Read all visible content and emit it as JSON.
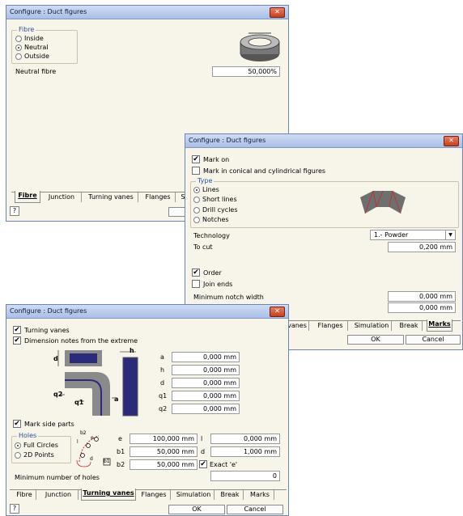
{
  "colors": {
    "title_bar": "#b7cae9",
    "window_bg": "#f7f4e9",
    "accent": "#2f4f9f",
    "close": "#d45a3a"
  },
  "w1": {
    "title": "Configure : Duct figures",
    "fibre_group": "Fibre",
    "options": [
      "Inside",
      "Neutral",
      "Outside"
    ],
    "selected": "Neutral",
    "neutral_fibre_label": "Neutral fibre",
    "neutral_fibre_value": "50,000%",
    "tabs": [
      "Fibre",
      "Junction",
      "Turning vanes",
      "Flanges",
      "Si"
    ],
    "active_tab": "Fibre",
    "help_icon": "help-icon"
  },
  "w2": {
    "title": "Configure : Duct figures",
    "mark_on": "Mark on",
    "mark_conical": "Mark in conical and cylindrical figures",
    "type_group": "Type",
    "type_options": [
      "Lines",
      "Short lines",
      "Drill cycles",
      "Notches"
    ],
    "type_selected": "Lines",
    "technology_label": "Technology",
    "technology_value": "1.- Powder",
    "to_cut_label": "To cut",
    "to_cut_value": "0,200 mm",
    "order": "Order",
    "join_ends": "Join ends",
    "min_notch_label": "Minimum notch width",
    "min_notch_value": "0,000 mm",
    "extra_value": "0,000 mm",
    "tabs": [
      "vanes",
      "Flanges",
      "Simulation",
      "Break",
      "Marks"
    ],
    "active_tab": "Marks",
    "ok": "OK",
    "cancel": "Cancel"
  },
  "w3": {
    "title": "Configure : Duct figures",
    "turning_vanes": "Turning vanes",
    "dimension_notes": "Dimension notes from the extreme",
    "dims": [
      {
        "label": "a",
        "value": "0,000 mm"
      },
      {
        "label": "h",
        "value": "0,000 mm"
      },
      {
        "label": "d",
        "value": "0,000 mm"
      },
      {
        "label": "q1",
        "value": "0,000 mm"
      },
      {
        "label": "q2",
        "value": "0,000 mm"
      }
    ],
    "diagram_labels": {
      "d": "d",
      "h": "h",
      "q2": "q2",
      "q1": "q1",
      "a": "a"
    },
    "mark_side_parts": "Mark side parts",
    "holes_group": "Holes",
    "hole_options": [
      "Full Circles",
      "2D Points"
    ],
    "hole_selected": "Full Circles",
    "hole_diagram_labels": {
      "b2": "b2",
      "b1": "b1",
      "d": "d",
      "e": "e",
      "l": "l"
    },
    "e_label": "e",
    "e_value": "100,000 mm",
    "b1_label": "b1",
    "b1_value": "50,000 mm",
    "b2_label": "b2",
    "b2_value": "50,000 mm",
    "l_label": "l",
    "l_value": "0,000 mm",
    "d_label": "d",
    "d_value": "1,000 mm",
    "exact_e": "Exact 'e'",
    "min_holes_label": "Minimum number of holes",
    "min_holes_value": "0",
    "tabs": [
      "Fibre",
      "Junction",
      "Turning vanes",
      "Flanges",
      "Simulation",
      "Break",
      "Marks"
    ],
    "active_tab": "Turning vanes",
    "ok": "OK",
    "cancel": "Cancel",
    "help_icon": "help-icon"
  }
}
